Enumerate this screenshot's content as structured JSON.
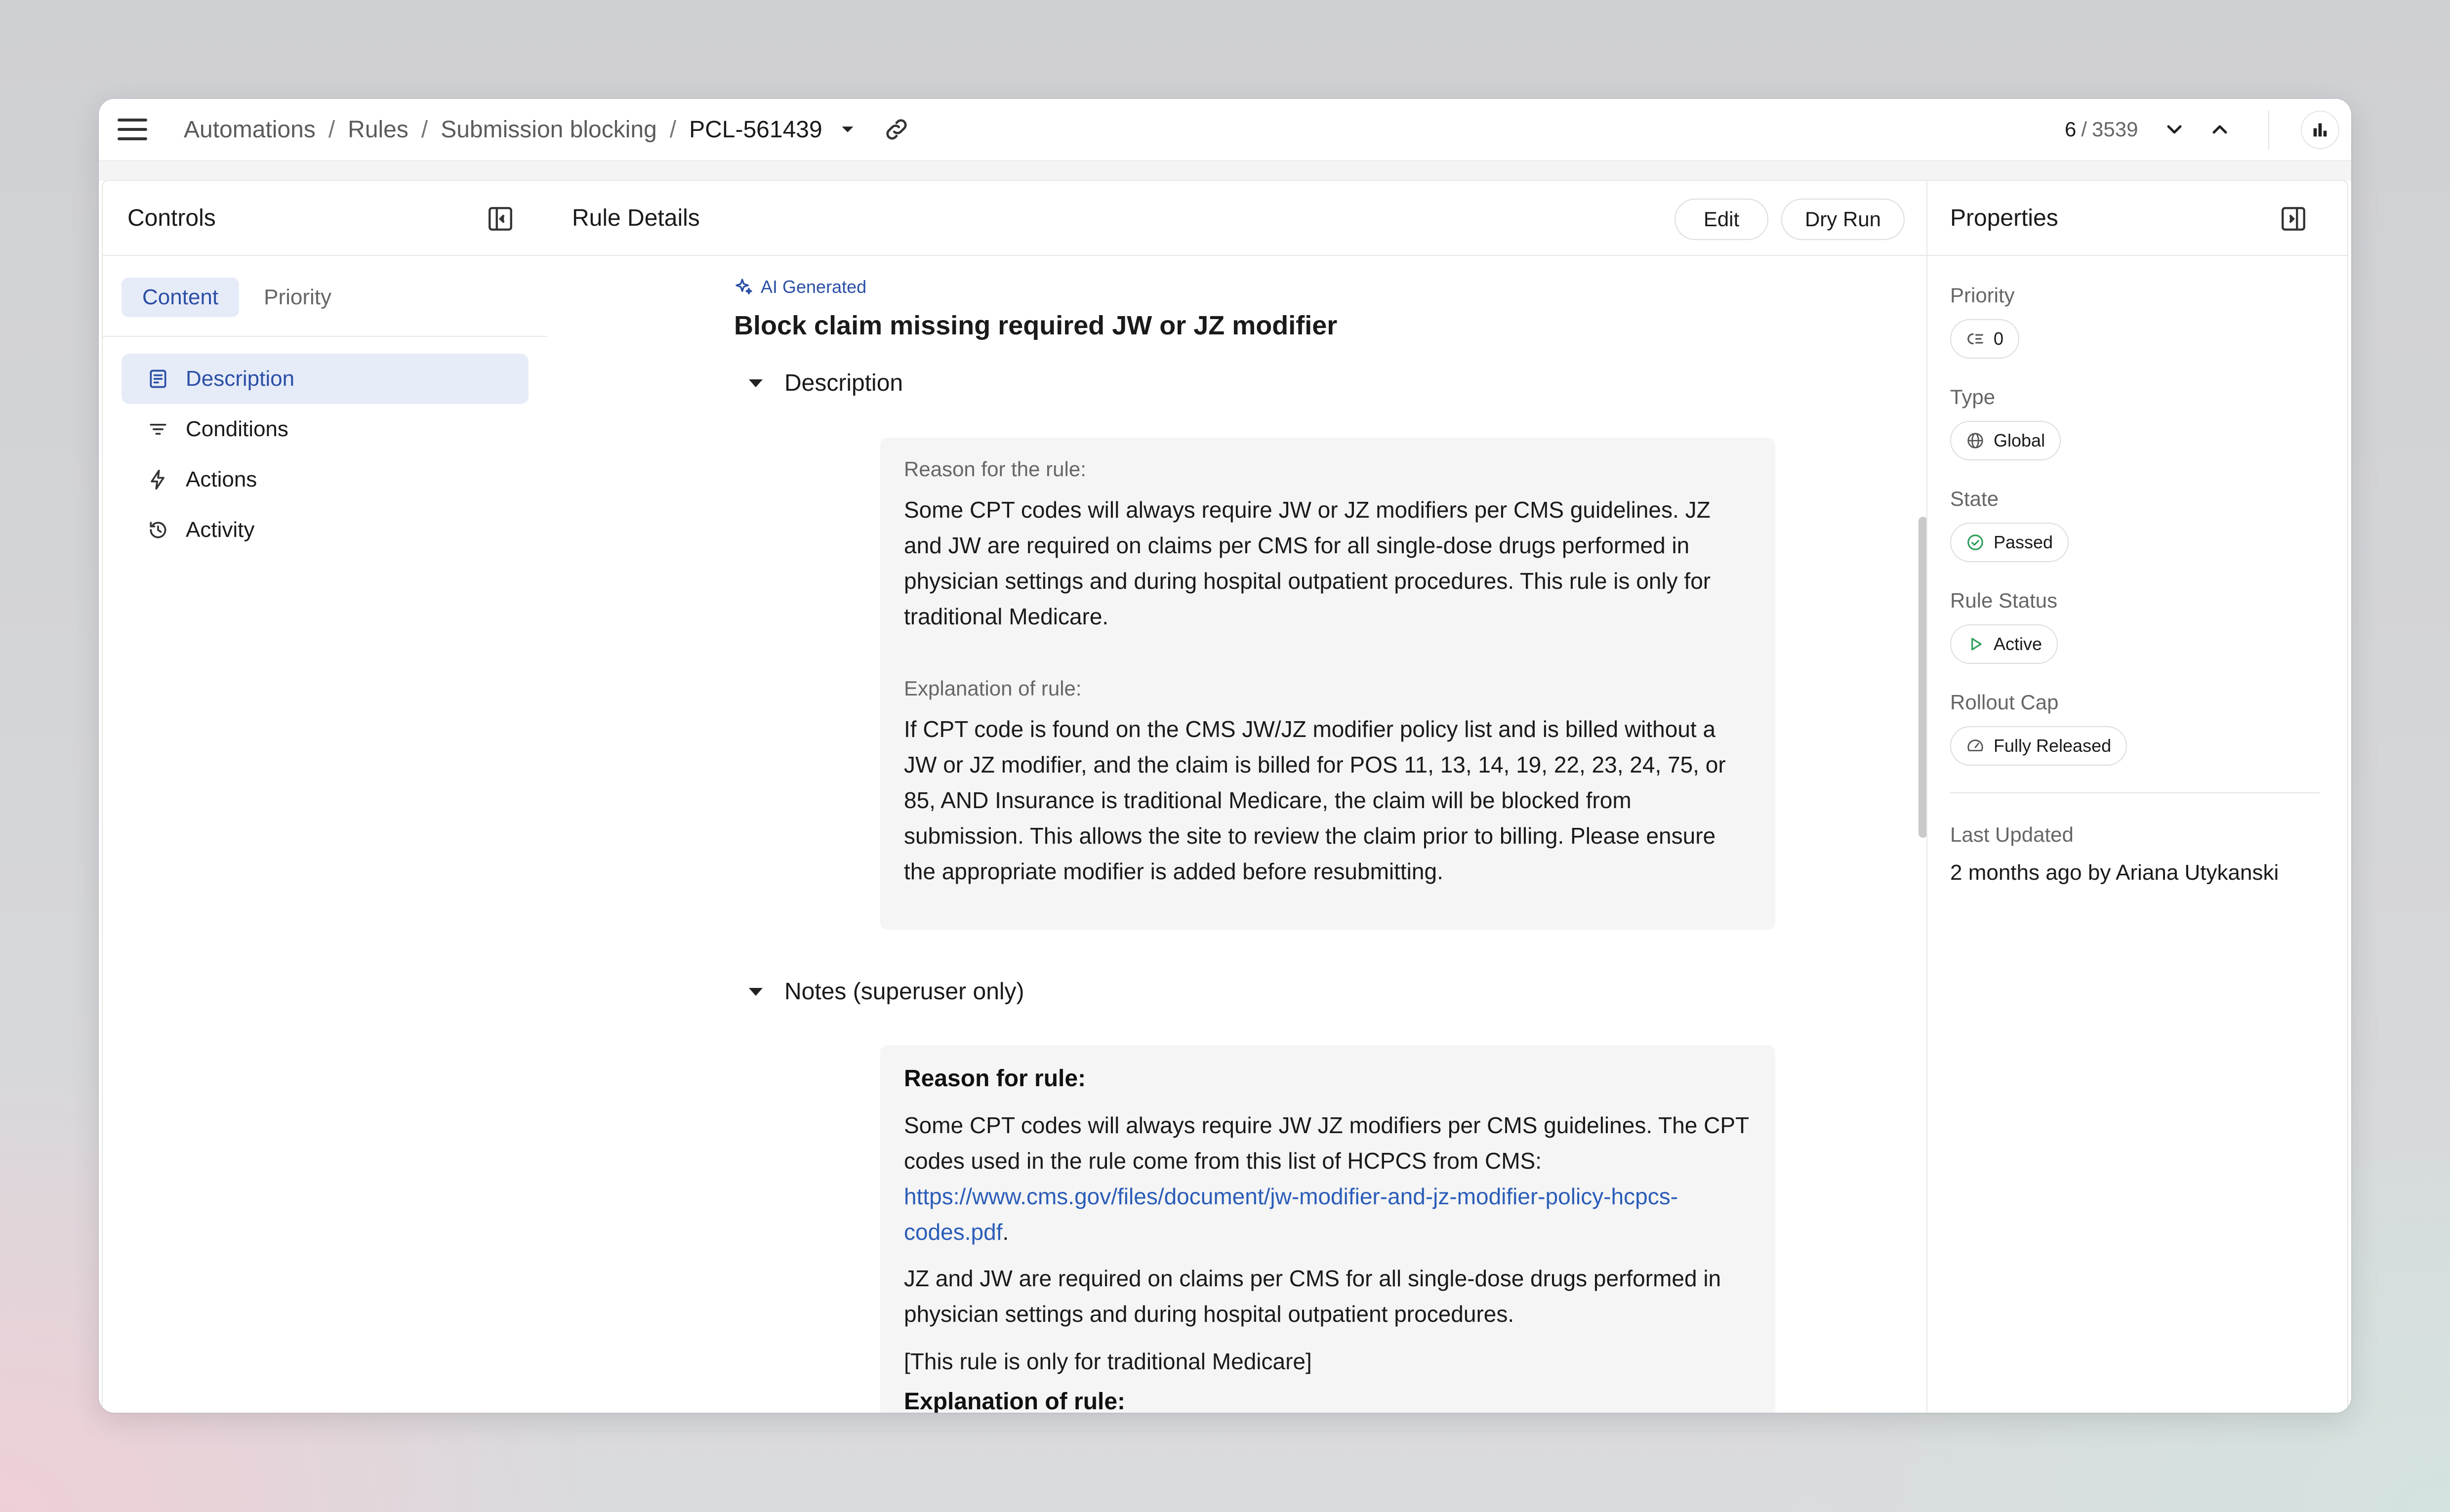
{
  "breadcrumb": {
    "items": [
      "Automations",
      "Rules",
      "Submission blocking"
    ],
    "separator": "/",
    "current": "PCL-561439"
  },
  "pager": {
    "current": "6",
    "total": "3539"
  },
  "controls": {
    "title": "Controls",
    "tabs": [
      "Content",
      "Priority"
    ],
    "nav": [
      {
        "label": "Description",
        "icon": "description-icon"
      },
      {
        "label": "Conditions",
        "icon": "filter-icon"
      },
      {
        "label": "Actions",
        "icon": "lightning-icon"
      },
      {
        "label": "Activity",
        "icon": "history-icon"
      }
    ]
  },
  "rule_details": {
    "title": "Rule Details",
    "edit_label": "Edit",
    "dry_run_label": "Dry Run",
    "ai_badge": "AI Generated",
    "rule_title": "Block claim missing required JW or JZ modifier",
    "description": {
      "heading": "Description",
      "reason_label": "Reason for the rule:",
      "reason_text": "Some CPT codes will always require JW or JZ modifiers per CMS guidelines. JZ and JW are required on claims per CMS for all single-dose drugs performed in physician settings and during hospital outpatient procedures. This rule is only for traditional Medicare.",
      "explanation_label": "Explanation of rule:",
      "explanation_text": "If CPT code is found on the CMS JW/JZ modifier policy list and is billed without a JW or JZ modifier, and the claim is billed for POS 11, 13, 14, 19, 22, 23, 24, 75, or 85, AND Insurance is traditional Medicare, the claim will be blocked from submission. This allows the site to review the claim prior to billing. Please ensure the appropriate modifier is added before resubmitting."
    },
    "notes": {
      "heading": "Notes (superuser only)",
      "reason_heading": "Reason for rule:",
      "para1": "Some CPT codes will always require JW JZ modifiers per CMS guidelines. The CPT codes used in the rule come from this list of HCPCS from CMS:",
      "link": "https://www.cms.gov/files/document/jw-modifier-and-jz-modifier-policy-hcpcs-codes.pdf",
      "link_suffix": ".",
      "para2": "JZ and JW are required on claims per CMS for all single-dose drugs performed in physician settings and during hospital outpatient procedures.",
      "para3": "[This rule is only for traditional Medicare]",
      "explanation_heading": "Explanation of rule:"
    }
  },
  "properties": {
    "title": "Properties",
    "priority": {
      "label": "Priority",
      "value": "0",
      "icon": "priority-icon"
    },
    "type": {
      "label": "Type",
      "value": "Global",
      "icon": "globe-icon"
    },
    "state": {
      "label": "State",
      "value": "Passed",
      "icon": "check-circle-icon",
      "color": "#2e9e5b"
    },
    "rule_status": {
      "label": "Rule Status",
      "value": "Active",
      "icon": "play-icon",
      "color": "#2e9e5b"
    },
    "rollout_cap": {
      "label": "Rollout Cap",
      "value": "Fully Released",
      "icon": "gauge-icon"
    },
    "last_updated": {
      "label": "Last Updated",
      "value": "2 months ago by Ariana Utykanski"
    }
  },
  "colors": {
    "accent": "#2b4fa5",
    "accent_bg": "#e6ebf8",
    "link": "#2b5db8"
  }
}
